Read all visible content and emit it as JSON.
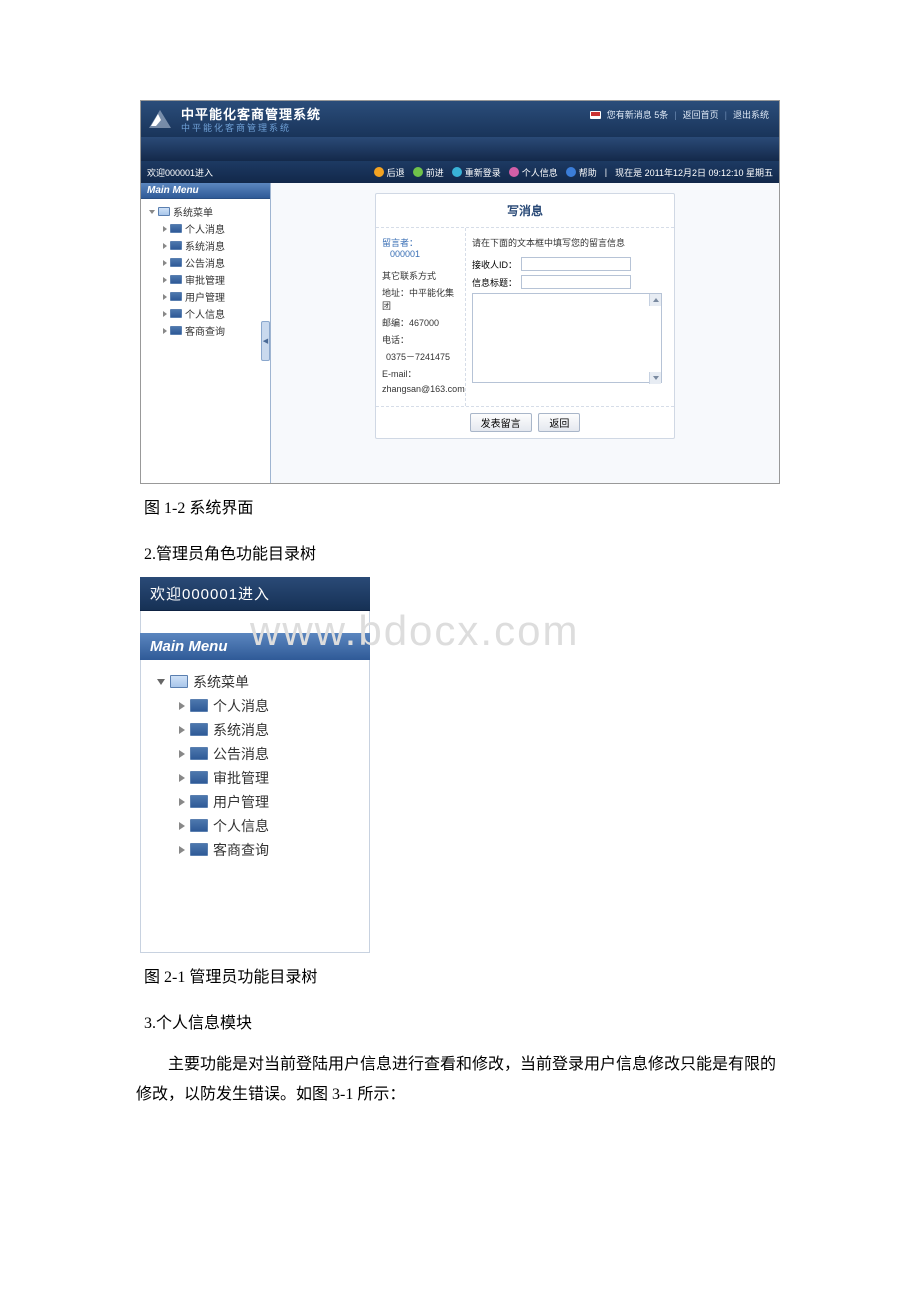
{
  "watermark": "www.bdocx.com",
  "doc": {
    "caption1": "图 1-2 系统界面",
    "section2_title": "2.管理员角色功能目录树",
    "caption2": "图 2-1 管理员功能目录树",
    "section3_title": "3.个人信息模块",
    "section3_body": "主要功能是对当前登陆用户信息进行查看和修改，当前登录用户信息修改只能是有限的修改，以防发生错误。如图 3-1 所示："
  },
  "shot1": {
    "app_title": "中平能化客商管理系统",
    "app_subtitle": "中平能化客商管理系统",
    "toplinks": {
      "newmsg": "您有新消息 5条",
      "home": "返回首页",
      "logout": "退出系统"
    },
    "toolbar": {
      "welcome": "欢迎000001进入",
      "back": "后退",
      "forward": "前进",
      "relogin": "重新登录",
      "profile": "个人信息",
      "help": "帮助",
      "time": "现在是 2011年12月2日 09:12:10 星期五"
    },
    "sidebar": {
      "main_menu": "Main Menu",
      "root": "系统菜单",
      "items": [
        "个人消息",
        "系统消息",
        "公告消息",
        "审批管理",
        "用户管理",
        "个人信息",
        "客商查询"
      ]
    },
    "panel": {
      "title": "写消息",
      "author_label": "留言者：",
      "author_id": "000001",
      "other_contact": "其它联系方式",
      "address": "地址：中平能化集团",
      "postcode": "邮编：467000",
      "phone_label": "电话：",
      "phone": "0375－7241475",
      "email_label": "E-mail：",
      "email": "zhangsan@163.com",
      "instruction": "请在下面的文本框中填写您的留言信息",
      "recv_label": "接收人ID：",
      "subject_label": "信息标题：",
      "submit": "发表留言",
      "back": "返回"
    }
  },
  "shot2": {
    "welcome": "欢迎000001进入",
    "main_menu": "Main Menu",
    "root": "系统菜单",
    "items": [
      "个人消息",
      "系统消息",
      "公告消息",
      "审批管理",
      "用户管理",
      "个人信息",
      "客商查询"
    ]
  }
}
